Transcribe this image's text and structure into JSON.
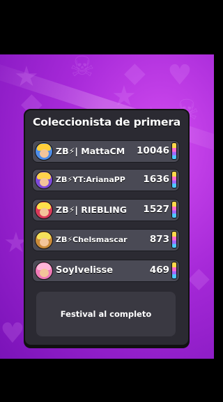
{
  "panel": {
    "title": "Coleccionista de primera",
    "footer": "Festival al completo"
  },
  "players": [
    {
      "name": "ZB⚡| MattaCM",
      "score": "10046",
      "avatar_colors": [
        "#4e8de8",
        "#ffcf3a"
      ]
    },
    {
      "name": "ZB⚡YT:ArianaPP",
      "score": "1636",
      "avatar_colors": [
        "#7d4ad8",
        "#ffd24a"
      ]
    },
    {
      "name": "ZB⚡| RIEBLING",
      "score": "1527",
      "avatar_colors": [
        "#d83a5a",
        "#ffe04a"
      ]
    },
    {
      "name": "ZB⚡Chelsmascar",
      "score": "873",
      "avatar_colors": [
        "#c98a3a",
        "#f4e05a"
      ]
    },
    {
      "name": "SoyIvelisse",
      "score": "469",
      "avatar_colors": [
        "#f07ab8",
        "#ffb5d8"
      ]
    }
  ],
  "icons": {
    "trophy_row_icon": "rainbow-token-icon",
    "avatar": "player-avatar"
  },
  "colors": {
    "background": "#a629d8",
    "panel": "#2b2a32",
    "row": "#4a4a55"
  }
}
